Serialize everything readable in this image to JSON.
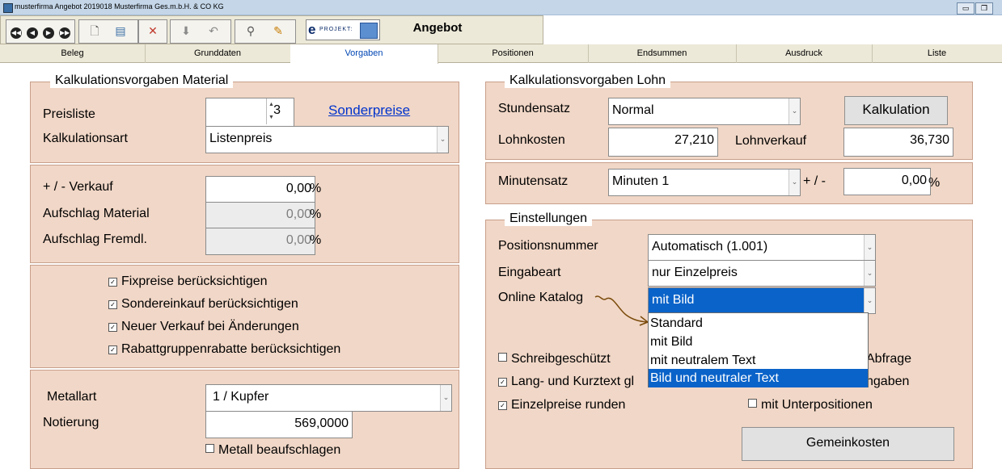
{
  "window": {
    "title": "musterfirma  Angebot  2019018  Musterfirma Ges.m.b.H. & CO KG",
    "heading": "Angebot",
    "minimize": "▭",
    "restore": "❐"
  },
  "logo": {
    "letter": "e",
    "text": "PROJEKT:"
  },
  "tabs": [
    {
      "label": "Beleg"
    },
    {
      "label": "Grunddaten"
    },
    {
      "label": "Vorgaben"
    },
    {
      "label": "Positionen"
    },
    {
      "label": "Endsummen"
    },
    {
      "label": "Ausdruck"
    },
    {
      "label": "Liste"
    }
  ],
  "material": {
    "legend": "Kalkulationsvorgaben  Material",
    "preisliste_label": "Preisliste",
    "preisliste_value": "3",
    "sonderpreise_link": "Sonderpreise",
    "kalkulationsart_label": "Kalkulationsart",
    "kalkulationsart_value": "Listenpreis",
    "verkauf_label": "+ / -   Verkauf",
    "verkauf_value": "0,00",
    "aufschlag_material_label": "Aufschlag Material",
    "aufschlag_material_value": "0,00",
    "aufschlag_fremdl_label": "Aufschlag Fremdl.",
    "aufschlag_fremdl_value": "0,00",
    "percent": "%",
    "checks": [
      {
        "label": "Fixpreise berücksichtigen",
        "checked": true
      },
      {
        "label": "Sondereinkauf berücksichtigen",
        "checked": true
      },
      {
        "label": "Neuer Verkauf bei Änderungen",
        "checked": true
      },
      {
        "label": "Rabattgruppenrabatte berücksichtigen",
        "checked": true
      }
    ],
    "metallart_label": "Metallart",
    "metallart_value": "1 / Kupfer",
    "notierung_label": "Notierung",
    "notierung_value": "569,0000",
    "metall_beaufschlagen_label": "Metall beaufschlagen"
  },
  "lohn": {
    "legend": "Kalkulationsvorgaben Lohn",
    "stundensatz_label": "Stundensatz",
    "stundensatz_value": "Normal",
    "kalkulation_button": "Kalkulation",
    "lohnkosten_label": "Lohnkosten",
    "lohnkosten_value": "27,210",
    "lohnverkauf_label": "Lohnverkauf",
    "lohnverkauf_value": "36,730",
    "minutensatz_label": "Minutensatz",
    "minutensatz_value": "Minuten 1",
    "plusminus_label": "+ / -",
    "plusminus_value": "0,00",
    "percent": "%"
  },
  "einstellungen": {
    "legend": "Einstellungen",
    "positionsnummer_label": "Positionsnummer",
    "positionsnummer_value": "Automatisch  (1.001)",
    "eingabeart_label": "Eingabeart",
    "eingabeart_value": "nur Einzelpreis",
    "online_katalog_label": "Online Katalog",
    "online_katalog_value": "mit Bild",
    "dropdown_options": [
      "Standard",
      "mit Bild",
      "mit neutralem Text",
      "Bild und neutraler Text"
    ],
    "schreibgeschuetzt_label": "Schreibgeschützt",
    "abfrage_fragment": "Abfrage",
    "lang_kurztext_fragment": "Lang- und Kurztext gl",
    "angaben_fragment": "ngaben",
    "einzelpreise_runden_label": "Einzelpreise runden",
    "mit_unterpositionen_label": "mit Unterpositionen",
    "gemeinkosten_button": "Gemeinkosten"
  },
  "colors": {
    "panel": "#f1d7c7",
    "selection": "#0a63c9",
    "link": "#0033cc",
    "active_tab": "#0046b4"
  }
}
